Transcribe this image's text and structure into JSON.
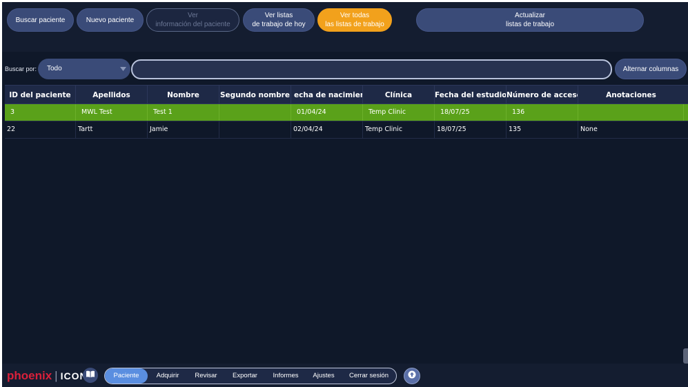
{
  "toolbar": {
    "search_patient": "Buscar paciente",
    "new_patient": "Nuevo paciente",
    "view_info_line1": "Ver",
    "view_info_line2": "información del paciente",
    "today_lists_line1": "Ver listas",
    "today_lists_line2": "de trabajo de hoy",
    "all_lists_line1": "Ver todas",
    "all_lists_line2": "las listas de trabajo",
    "refresh_line1": "Actualizar",
    "refresh_line2": "listas de trabajo"
  },
  "search": {
    "label": "Buscar por:",
    "selected": "Todo",
    "query": "",
    "toggle_columns": "Alternar columnas"
  },
  "table": {
    "columns": [
      "ID del paciente",
      "Apellidos",
      "Nombre",
      "Segundo nombre",
      "echa de nacimient",
      "Clínica",
      "Fecha del estudio",
      "Número de acceso",
      "Anotaciones"
    ],
    "rows": [
      [
        "3",
        "MWL Test",
        "Test 1",
        "",
        "01/04/24",
        "Temp Clinic",
        "18/07/25",
        "136",
        ""
      ],
      [
        "22",
        "Tartt",
        "Jamie",
        "",
        "02/04/24",
        "Temp Clinic",
        "18/07/25",
        "135",
        "None"
      ]
    ],
    "selected_row": 0
  },
  "bottom": {
    "logo_brand": "phoenix",
    "logo_suffix": "ICON",
    "nav": [
      "Paciente",
      "Adquirir",
      "Revisar",
      "Exportar",
      "Informes",
      "Ajustes",
      "Cerrar sesión"
    ],
    "active_nav": 0
  },
  "colors": {
    "background": "#0f1829",
    "button": "#3a4b78",
    "active_button": "#f2a11c",
    "selected_row": "#5aa11a",
    "nav_active": "#5a8ee0",
    "brand_red": "#d9203a"
  },
  "icons": [
    "book-icon",
    "upload-icon",
    "chevron-down-icon"
  ]
}
